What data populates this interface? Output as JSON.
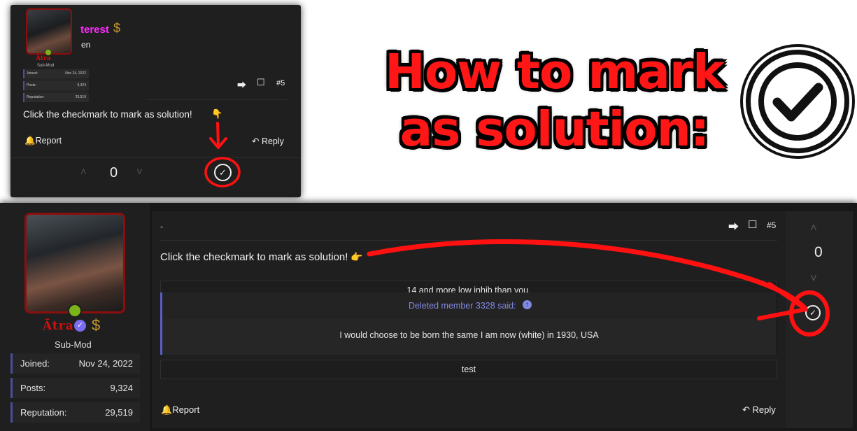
{
  "headline": {
    "line1": "How to mark",
    "line2": "as solution:"
  },
  "mini_screenshot": {
    "title_fragment": "terest",
    "subtitle_fragment": "en",
    "username": "Ātra",
    "role": "Sub-Mod",
    "stats": [
      {
        "label": "Joined:",
        "value": "Nov 24, 2022"
      },
      {
        "label": "Posts:",
        "value": "9,324"
      },
      {
        "label": "Reputation:",
        "value": "29,519"
      }
    ],
    "post_number": "#5",
    "message": "Click the checkmark to mark as solution!",
    "emoji": "👇",
    "report_label": "Report",
    "reply_label": "Reply",
    "vote_count": "0"
  },
  "sidebar": {
    "username": "Ātra",
    "role": "Sub-Mod",
    "stats": [
      {
        "label": "Joined:",
        "value": "Nov 24, 2022"
      },
      {
        "label": "Posts:",
        "value": "9,324"
      },
      {
        "label": "Reputation:",
        "value": "29,519"
      }
    ]
  },
  "post": {
    "title": "-",
    "post_number": "#5",
    "message": "Click the checkmark to mark as solution!",
    "emoji": "👉",
    "line1": "14 and more low inhib than you.",
    "quote_author": "Deleted member 3328 said:",
    "quote_text": "I would choose to be born the same I am now (white) in 1930, USA",
    "reply_text": "test",
    "report_label": "Report",
    "reply_label": "Reply",
    "vote_count": "0"
  },
  "colors": {
    "accent_red": "#ff1616",
    "quote_blue": "#5a5ec2",
    "online_green": "#7db31a",
    "gold": "#c59a2d"
  },
  "icons": [
    "share-icon",
    "bookmark-icon",
    "bell-icon",
    "reply-icon",
    "chevron-up-icon",
    "chevron-down-icon",
    "checkmark-circle-icon",
    "verified-badge-icon",
    "dollar-icon"
  ]
}
